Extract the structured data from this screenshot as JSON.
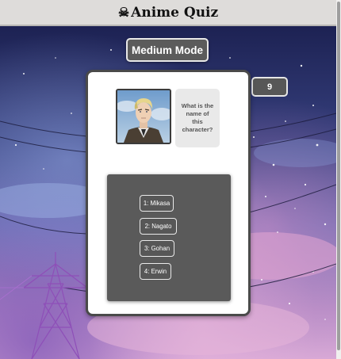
{
  "header": {
    "icon": "skull-crossbones-icon",
    "title": "Anime Quiz"
  },
  "mode": {
    "label": "Medium Mode"
  },
  "score": {
    "value": "9"
  },
  "quiz": {
    "question": "What is the name of this character?",
    "answers": [
      {
        "label": "1: Mikasa"
      },
      {
        "label": "2: Nagato"
      },
      {
        "label": "3: Gohan"
      },
      {
        "label": "4: Erwin"
      }
    ]
  },
  "colors": {
    "header_bg": "#dedcda",
    "button_bg": "#5b5b5b",
    "card_bg": "#ffffff",
    "answers_panel_bg": "#5a5a5a"
  }
}
